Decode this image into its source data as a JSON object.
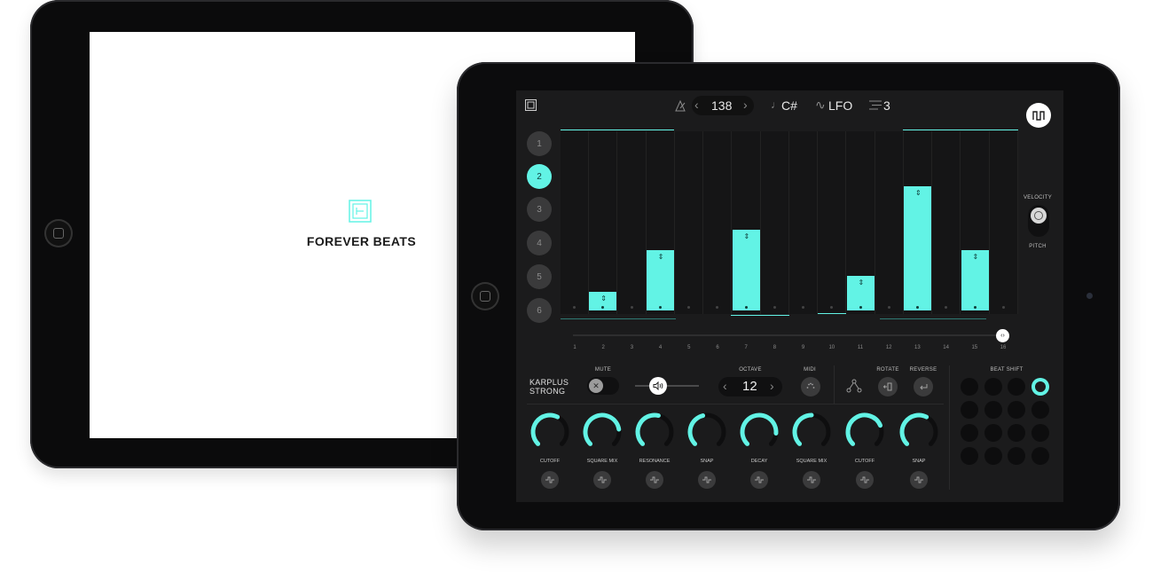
{
  "brand": {
    "name": "FOREVER BEATS"
  },
  "colors": {
    "accent": "#62f3e5",
    "screen_bg": "#1b1b1c",
    "bezel": "#0c0c0d"
  },
  "top_bar": {
    "tempo": "138",
    "tempo_prev": "‹",
    "tempo_next": "›",
    "key_glyph": "♩",
    "key": "C#",
    "lfo_glyph": "∿",
    "lfo_label": "LFO",
    "steps_value": "3"
  },
  "tracks": [
    "1",
    "2",
    "3",
    "4",
    "5",
    "6"
  ],
  "active_track": "2",
  "sequencer": {
    "step_labels": [
      "1",
      "2",
      "3",
      "4",
      "5",
      "6",
      "7",
      "8",
      "9",
      "10",
      "11",
      "12",
      "13",
      "14",
      "15",
      "16"
    ],
    "velocities": [
      0,
      0.11,
      0,
      0.35,
      0,
      0,
      0.47,
      0,
      0,
      0,
      0.2,
      0,
      0.72,
      0,
      0.35,
      0
    ],
    "arrow_glyph": "⇕"
  },
  "side_labels": {
    "velocity": "VELOCITY",
    "pitch": "PITCH"
  },
  "instrument": {
    "name_line1": "KARPLUS",
    "name_line2": "STRONG",
    "mute_label": "MUTE",
    "octave_label": "OCTAVE",
    "octave_value": "12",
    "midi_label": "MIDI",
    "rotate_label": "ROTATE",
    "reverse_label": "REVERSE",
    "beat_shift_label": "BEAT SHIFT"
  },
  "knobs": [
    {
      "label": "CUTOFF",
      "level": 0.6
    },
    {
      "label": "SQUARE MIX",
      "level": 0.8
    },
    {
      "label": "RESONANCE",
      "level": 0.55
    },
    {
      "label": "SNAP",
      "level": 0.45
    },
    {
      "label": "DECAY",
      "level": 0.85
    },
    {
      "label": "SQUARE MIX",
      "level": 0.5
    },
    {
      "label": "CUTOFF",
      "level": 0.75
    },
    {
      "label": "SNAP",
      "level": 0.6
    }
  ]
}
